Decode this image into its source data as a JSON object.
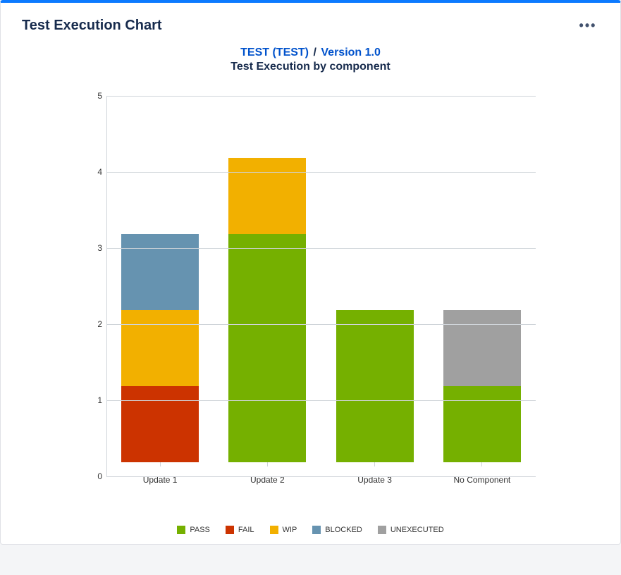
{
  "header": {
    "title": "Test Execution Chart",
    "more_label": "•••"
  },
  "breadcrumb": {
    "project": "TEST (TEST)",
    "version": "Version 1.0",
    "sep": "/"
  },
  "subtitle": "Test Execution by component",
  "colors": {
    "PASS": "#75b000",
    "FAIL": "#cc3300",
    "WIP": "#f2b000",
    "BLOCKED": "#6693b0",
    "UNEXECUTED": "#a0a0a0"
  },
  "chart_data": {
    "type": "bar",
    "stacked": true,
    "ylim": [
      0,
      5
    ],
    "yticks": [
      0,
      1,
      2,
      3,
      4,
      5
    ],
    "xlabel": "",
    "ylabel": "",
    "categories": [
      "Update 1",
      "Update 2",
      "Update 3",
      "No Component"
    ],
    "series": [
      {
        "name": "PASS",
        "values": [
          0,
          3,
          2,
          1
        ]
      },
      {
        "name": "FAIL",
        "values": [
          1,
          0,
          0,
          0
        ]
      },
      {
        "name": "WIP",
        "values": [
          1,
          1,
          0,
          0
        ]
      },
      {
        "name": "BLOCKED",
        "values": [
          1,
          0,
          0,
          0
        ]
      },
      {
        "name": "UNEXECUTED",
        "values": [
          0,
          0,
          0,
          1
        ]
      }
    ],
    "legend": [
      "PASS",
      "FAIL",
      "WIP",
      "BLOCKED",
      "UNEXECUTED"
    ]
  }
}
